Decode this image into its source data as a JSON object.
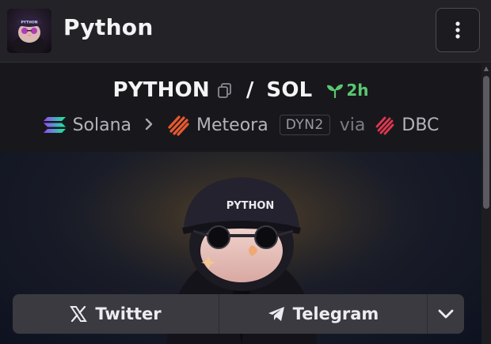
{
  "header": {
    "title": "Python",
    "avatar_text": "PYTHON",
    "menu_icon": "vertical-dots-icon"
  },
  "pair": {
    "base_symbol": "PYTHON",
    "separator": "/",
    "quote_symbol": "SOL",
    "age": "2h",
    "copy_icon": "copy-icon",
    "age_icon": "sprout-icon"
  },
  "chain": {
    "network": "Solana",
    "dex": "Meteora",
    "pool_type": "DYN2",
    "via_label": "via",
    "launchpad": "DBC"
  },
  "banner": {
    "cap_text": "PYTHON"
  },
  "social": {
    "twitter_label": "Twitter",
    "telegram_label": "Telegram",
    "expand_icon": "chevron-down-icon"
  },
  "colors": {
    "age_green": "#5ac771",
    "meteora_orange": "#e8592f",
    "dbc_red": "#e0364f",
    "solana_gradient": [
      "#9945ff",
      "#14f195"
    ]
  }
}
